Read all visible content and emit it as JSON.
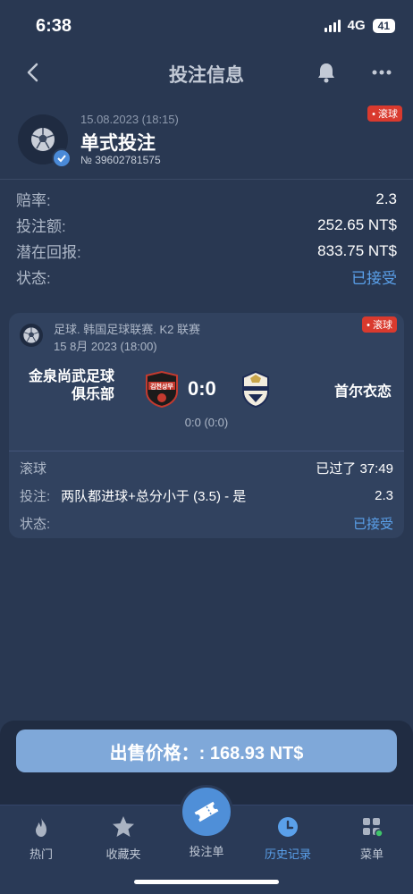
{
  "status_bar": {
    "time": "6:38",
    "network": "4G",
    "battery": "41"
  },
  "header": {
    "title": "投注信息"
  },
  "bet": {
    "date": "15.08.2023 (18:15)",
    "type": "单式投注",
    "number": "№ 39602781575",
    "live_badge": "• 滚球"
  },
  "summary": {
    "odds_label": "赔率:",
    "odds_value": "2.3",
    "stake_label": "投注额:",
    "stake_value": "252.65 NT$",
    "payout_label": "潜在回报:",
    "payout_value": "833.75 NT$",
    "status_label": "状态:",
    "status_value": "已接受"
  },
  "match": {
    "league": "足球. 韩国足球联赛. K2 联赛",
    "date": "15 8月 2023 (18:00)",
    "live_badge": "• 滚球",
    "home_team": "金泉尚武足球俱乐部",
    "away_team": "首尔衣恋",
    "home_crest_text": "김천상무",
    "score": "0:0",
    "halftime": "0:0 (0:0)",
    "live_label": "滚球",
    "elapsed": "已过了 37:49",
    "bet_label": "投注:",
    "selection": "两队都进球+总分小于 (3.5) - 是",
    "selection_odds": "2.3",
    "status_label": "状态:",
    "status_value": "已接受"
  },
  "sell_button": "出售价格：: 168.93 NT$",
  "tabbar": {
    "hot": "热门",
    "favorites": "收藏夹",
    "betslip": "投注单",
    "history": "历史记录",
    "menu": "菜单"
  },
  "colors": {
    "accent": "#5aa0ea",
    "live": "#d93a2e",
    "background": "#293852"
  }
}
